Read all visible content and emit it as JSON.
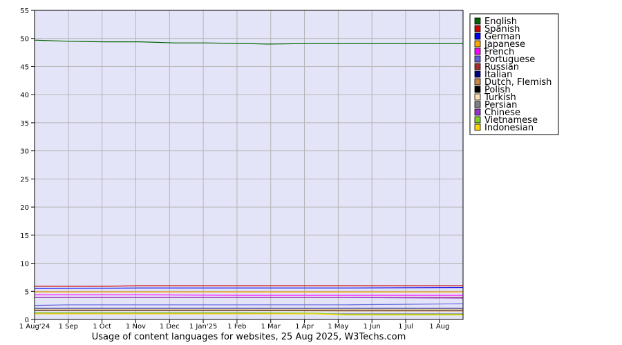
{
  "chart_data": {
    "type": "line",
    "title": "",
    "caption": "Usage of content languages for websites, 25 Aug 2025, W3Techs.com",
    "xlabel": "",
    "ylabel": "",
    "ylim": [
      0,
      55
    ],
    "yticks": [
      "0",
      "5",
      "10",
      "15",
      "20",
      "25",
      "30",
      "35",
      "40",
      "45",
      "50",
      "55"
    ],
    "xlim": [
      0,
      55
    ],
    "xticks": [
      "1 Aug'24",
      "1 Sep",
      "1 Oct",
      "1 Nov",
      "1 Dec",
      "1 Jan'25",
      "1 Feb",
      "1 Mar",
      "1 Apr",
      "1 May",
      "1 Jun",
      "1 Jul",
      "1 Aug"
    ],
    "grid": true,
    "legend_position": "right",
    "plot_background": "#e4e4f8",
    "series": [
      {
        "name": "English",
        "color": "#006400",
        "x": [
          0,
          4.5,
          9,
          13.5,
          18,
          22,
          27,
          30,
          35,
          40,
          45,
          55
        ],
        "values": [
          49.7,
          49.5,
          49.4,
          49.4,
          49.2,
          49.2,
          49.1,
          49.0,
          49.1,
          49.1,
          49.1,
          49.1
        ]
      },
      {
        "name": "Spanish",
        "color": "#cc0000",
        "x": [
          0,
          9,
          13.5,
          18,
          30,
          45,
          55
        ],
        "values": [
          5.9,
          5.9,
          6.0,
          6.0,
          6.0,
          6.0,
          6.0
        ]
      },
      {
        "name": "German",
        "color": "#0000ee",
        "x": [
          0,
          13.5,
          27,
          40,
          55
        ],
        "values": [
          5.5,
          5.6,
          5.6,
          5.6,
          5.7
        ]
      },
      {
        "name": "Japanese",
        "color": "#ffa500",
        "x": [
          0,
          13.5,
          27,
          40,
          55
        ],
        "values": [
          4.9,
          4.9,
          4.9,
          4.9,
          4.9
        ]
      },
      {
        "name": "French",
        "color": "#ff00ff",
        "x": [
          0,
          13.5,
          27,
          40,
          55
        ],
        "values": [
          4.4,
          4.4,
          4.3,
          4.3,
          4.3
        ]
      },
      {
        "name": "Portuguese",
        "color": "#6060dd",
        "x": [
          0,
          4.5,
          13.5,
          27,
          40,
          48,
          55
        ],
        "values": [
          2.5,
          2.6,
          2.6,
          2.6,
          2.6,
          2.7,
          2.8
        ]
      },
      {
        "name": "Russian",
        "color": "#a52a2a",
        "x": [
          0,
          13.5,
          27,
          40,
          55
        ],
        "values": [
          3.9,
          3.9,
          3.9,
          3.9,
          3.9
        ]
      },
      {
        "name": "Italian",
        "color": "#000080",
        "x": [
          0,
          13.5,
          27,
          40,
          55
        ],
        "values": [
          2.0,
          2.0,
          2.0,
          2.0,
          2.0
        ]
      },
      {
        "name": "Dutch, Flemish",
        "color": "#cd853f",
        "x": [
          0,
          13.5,
          27,
          40,
          54,
          55
        ],
        "values": [
          1.6,
          1.6,
          1.6,
          1.5,
          1.5,
          1.5
        ]
      },
      {
        "name": "Polish",
        "color": "#000000",
        "x": [
          0,
          13.5,
          27,
          40,
          55
        ],
        "values": [
          1.7,
          1.7,
          1.7,
          1.7,
          1.7
        ]
      },
      {
        "name": "Turkish",
        "color": "#ffdead",
        "x": [
          0,
          13.5,
          27,
          40,
          55
        ],
        "values": [
          1.8,
          1.8,
          1.8,
          1.8,
          1.8
        ]
      },
      {
        "name": "Persian",
        "color": "#808080",
        "x": [
          0,
          13.5,
          27,
          40,
          55
        ],
        "values": [
          1.1,
          1.1,
          1.1,
          1.0,
          1.0
        ]
      },
      {
        "name": "Chinese",
        "color": "#9932cc",
        "x": [
          0,
          13.5,
          27,
          40,
          55
        ],
        "values": [
          3.9,
          3.9,
          3.9,
          3.9,
          3.8
        ]
      },
      {
        "name": "Vietnamese",
        "color": "#7fd020",
        "x": [
          0,
          13.5,
          27,
          36,
          40,
          55
        ],
        "values": [
          1.2,
          1.2,
          1.2,
          1.1,
          0.9,
          0.9
        ]
      },
      {
        "name": "Indonesian",
        "color": "#ffd700",
        "x": [
          0,
          13.5,
          27,
          36,
          40,
          55
        ],
        "values": [
          1.0,
          1.0,
          1.0,
          1.0,
          0.8,
          0.8
        ]
      }
    ]
  }
}
